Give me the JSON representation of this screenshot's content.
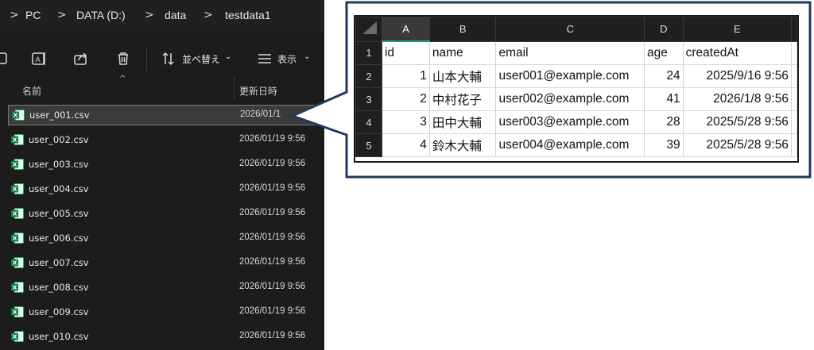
{
  "breadcrumb": [
    ">",
    "PC",
    ">",
    "DATA (D:)",
    ">",
    "data",
    ">",
    "testdata1"
  ],
  "toolbar": {
    "sort_label": "並べ替え",
    "view_label": "表示"
  },
  "columns": {
    "name": "名前",
    "date": "更新日時"
  },
  "files": [
    {
      "name": "user_001.csv",
      "date": "2026/01/1"
    },
    {
      "name": "user_002.csv",
      "date": "2026/01/19 9:56"
    },
    {
      "name": "user_003.csv",
      "date": "2026/01/19 9:56"
    },
    {
      "name": "user_004.csv",
      "date": "2026/01/19 9:56"
    },
    {
      "name": "user_005.csv",
      "date": "2026/01/19 9:56"
    },
    {
      "name": "user_006.csv",
      "date": "2026/01/19 9:56"
    },
    {
      "name": "user_007.csv",
      "date": "2026/01/19 9:56"
    },
    {
      "name": "user_008.csv",
      "date": "2026/01/19 9:56"
    },
    {
      "name": "user_009.csv",
      "date": "2026/01/19 9:56"
    },
    {
      "name": "user_010.csv",
      "date": "2026/01/19 9:56"
    }
  ],
  "sheet": {
    "col_letters": [
      "A",
      "B",
      "C",
      "D",
      "E"
    ],
    "row_numbers": [
      "1",
      "2",
      "3",
      "4",
      "5"
    ],
    "header": [
      "id",
      "name",
      "email",
      "age",
      "createdAt"
    ],
    "rows": [
      [
        "1",
        "山本大輔",
        "user001@example.com",
        "24",
        "2025/9/16 9:56"
      ],
      [
        "2",
        "中村花子",
        "user002@example.com",
        "41",
        "2026/1/8 9:56"
      ],
      [
        "3",
        "田中大輔",
        "user003@example.com",
        "28",
        "2025/5/28 9:56"
      ],
      [
        "4",
        "鈴木大輔",
        "user004@example.com",
        "39",
        "2025/5/28 9:56"
      ]
    ]
  },
  "colors": {
    "explorer_bg": "#1c1c1c",
    "callout_border": "#1f3a5c",
    "excel_green": "#21a366"
  }
}
